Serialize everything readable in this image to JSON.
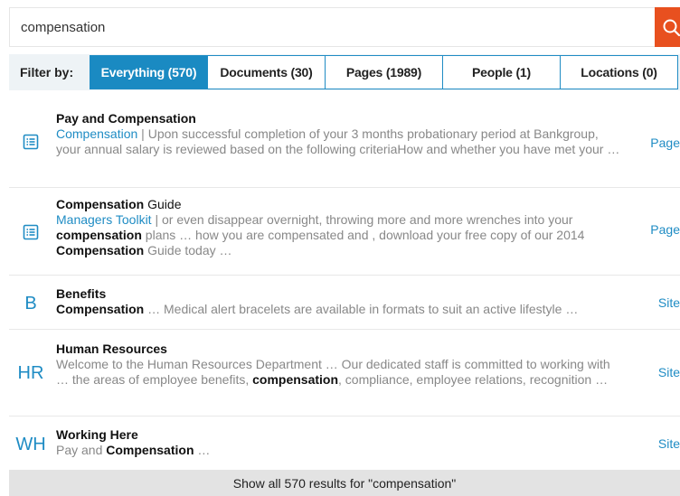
{
  "search": {
    "value": "compensation"
  },
  "filter": {
    "label": "Filter by:",
    "tabs": [
      {
        "label": "Everything (570)",
        "active": true
      },
      {
        "label": "Documents (30)",
        "active": false
      },
      {
        "label": "Pages (1989)",
        "active": false
      },
      {
        "label": "People (1)",
        "active": false
      },
      {
        "label": "Locations (0)",
        "active": false
      }
    ]
  },
  "results": [
    {
      "icon": "page-icon",
      "title": "Pay and Compensation",
      "source": "Compensation",
      "separator": " | ",
      "snippet_1": "Upon successful completion of your 3 months probationary period at Bankgroup, your annual salary is reviewed based on the following criteriaHow and whether you have met your …",
      "type": "Page"
    },
    {
      "icon": "page-icon",
      "title_bold": "Compensation",
      "title_rest": " Guide",
      "source": "Managers Toolkit",
      "separator": " | ",
      "snippet_1": "or even disappear overnight, throwing more and more wrenches into your ",
      "bold_1": "compensation",
      "snippet_2": " plans … how you are compensated and , download your free copy of our 2014 ",
      "bold_2": "Compensation",
      "snippet_3": " Guide today …",
      "type": "Page"
    },
    {
      "icon_text": "B",
      "title": "Benefits",
      "bold_1": "Compensation",
      "snippet_1": " … Medical alert bracelets are available in formats to suit an active lifestyle …",
      "type": "Site"
    },
    {
      "icon_text": "HR",
      "title": "Human Resources",
      "snippet_1": "Welcome to the Human Resources Department … Our dedicated staff is committed to working with … the areas of employee benefits, ",
      "bold_1": "compensation",
      "snippet_2": ", compliance, employee relations, recognition …",
      "type": "Site"
    },
    {
      "icon_text": "WH",
      "title": "Working Here",
      "snippet_1": "Pay and ",
      "bold_1": "Compensation",
      "snippet_2": " …",
      "type": "Site"
    }
  ],
  "footer": {
    "show_all": "Show all 570 results for \"compensation\""
  },
  "colors": {
    "accent": "#1a8ac2",
    "search_button": "#e8501f"
  }
}
